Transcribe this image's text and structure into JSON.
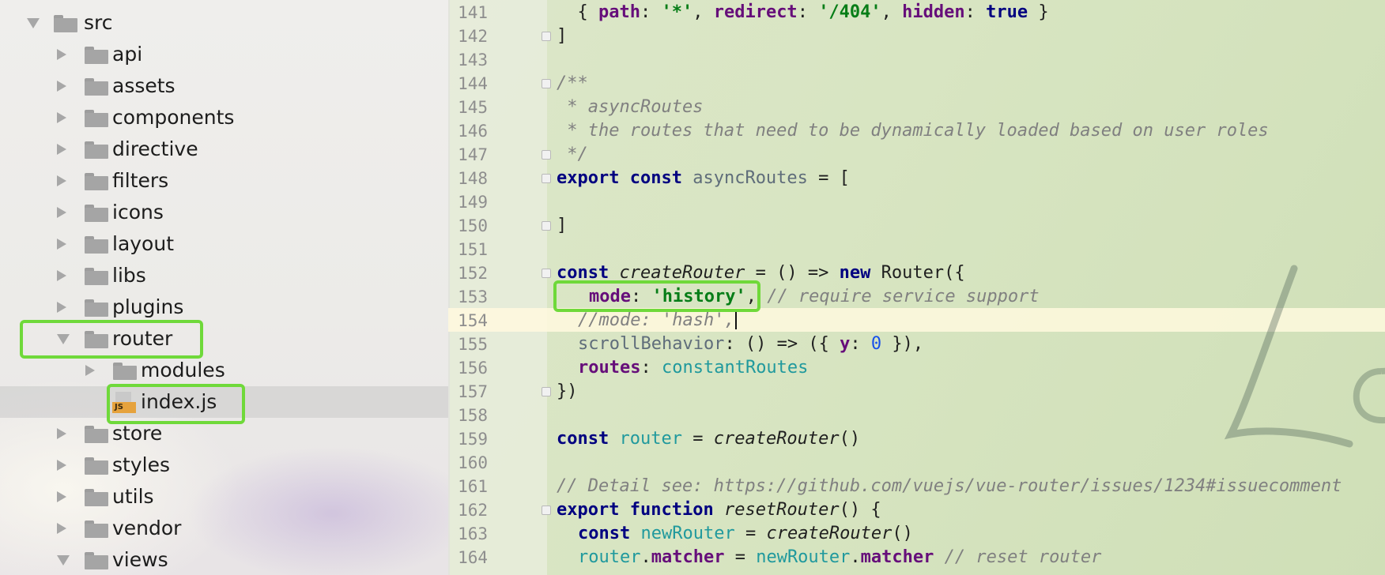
{
  "tree": {
    "items": [
      {
        "label": "src",
        "expanded": true
      },
      {
        "label": "api",
        "expanded": false
      },
      {
        "label": "assets",
        "expanded": false
      },
      {
        "label": "components",
        "expanded": false
      },
      {
        "label": "directive",
        "expanded": false
      },
      {
        "label": "filters",
        "expanded": false
      },
      {
        "label": "icons",
        "expanded": false
      },
      {
        "label": "layout",
        "expanded": false
      },
      {
        "label": "libs",
        "expanded": false
      },
      {
        "label": "plugins",
        "expanded": false
      },
      {
        "label": "router",
        "expanded": true
      },
      {
        "label": "modules",
        "expanded": false
      },
      {
        "label": "index.js",
        "file_badge": "JS",
        "selected": true
      },
      {
        "label": "store",
        "expanded": false
      },
      {
        "label": "styles",
        "expanded": false
      },
      {
        "label": "utils",
        "expanded": false
      },
      {
        "label": "vendor",
        "expanded": false
      },
      {
        "label": "views",
        "expanded": true
      }
    ]
  },
  "editor": {
    "line_numbers": [
      "141",
      "142",
      "143",
      "144",
      "145",
      "146",
      "147",
      "148",
      "149",
      "150",
      "151",
      "152",
      "153",
      "154",
      "155",
      "156",
      "157",
      "158",
      "159",
      "160",
      "161",
      "162",
      "163",
      "164"
    ],
    "lines": {
      "l141": {
        "a": "  { ",
        "b": "path",
        "c": ": ",
        "d": "'*'",
        "e": ", ",
        "f": "redirect",
        "g": ": ",
        "h": "'/404'",
        "i": ", ",
        "j": "hidden",
        "k": ": ",
        "l": "true",
        "m": " }"
      },
      "l142": "]",
      "l144": "/**",
      "l145": " * asyncRoutes",
      "l146": " * the routes that need to be dynamically loaded based on user roles",
      "l147": " */",
      "l148": {
        "kw1": "export",
        "kw2": "const",
        "name": "asyncRoutes",
        "rest": " = ["
      },
      "l150": "]",
      "l152": {
        "kw": "const",
        "fn": "createRouter",
        "mid": " = () => ",
        "kw2": "new",
        "rest": " Router({"
      },
      "l153": {
        "prop": "mode",
        "sep": ": ",
        "str": "'history'",
        "comma": ", ",
        "cmt": "// require service support"
      },
      "l154": "//mode: 'hash',",
      "l155": {
        "name": "scrollBehavior",
        "mid": ": () => ({ ",
        "prop": "y",
        "sep": ": ",
        "num": "0",
        "rest": " }),"
      },
      "l156": {
        "prop": "routes",
        "sep": ": ",
        "val": "constantRoutes"
      },
      "l157": "})",
      "l159": {
        "kw": "const",
        "name": "router",
        "mid": " = ",
        "fn": "createRouter",
        "rest": "()"
      },
      "l161": "// Detail see: https://github.com/vuejs/vue-router/issues/1234#issuecomment",
      "l162": {
        "kw1": "export",
        "kw2": "function",
        "fn": "resetRouter",
        "rest": "() {"
      },
      "l163": {
        "kw": "const",
        "name": "newRouter",
        "mid": " = ",
        "fn": "createRouter",
        "rest": "()"
      },
      "l164": {
        "a": "router",
        "b": ".",
        "c": "matcher",
        "d": " = ",
        "e": "newRouter",
        "f": ".",
        "g": "matcher",
        "h": " ",
        "i": "// reset router"
      }
    }
  },
  "colors": {
    "highlight": "#6fd93a",
    "keyword": "#000080",
    "string": "#067d17",
    "property": "#660e7a",
    "comment": "#808080",
    "js_badge": "#e6a23c"
  }
}
